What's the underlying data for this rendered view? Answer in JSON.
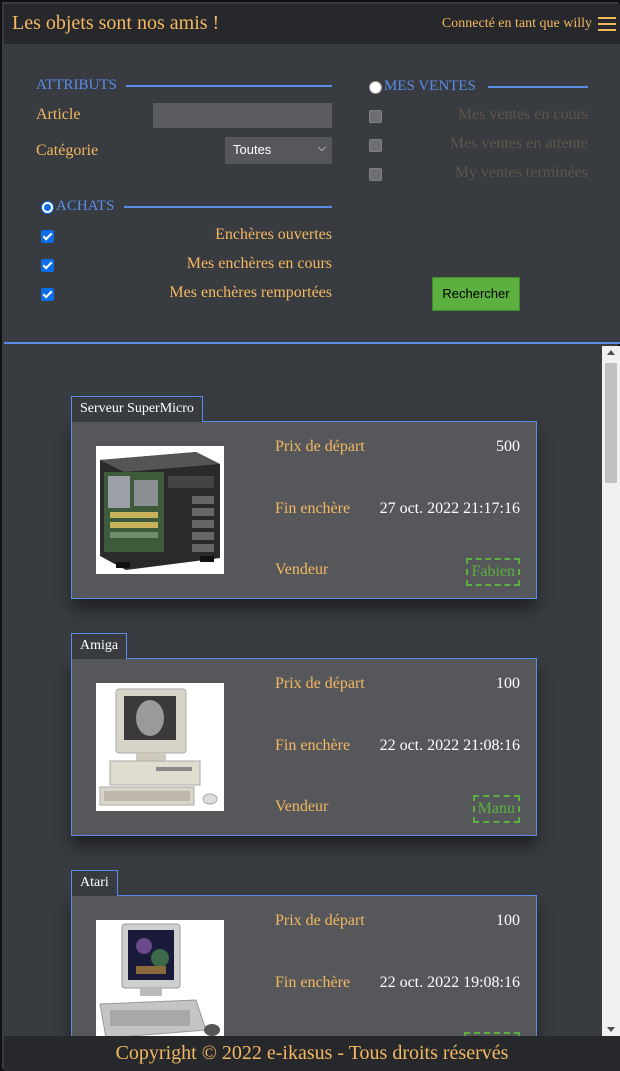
{
  "header": {
    "title": "Les objets sont nos amis !",
    "connected": "Connecté en tant que willy"
  },
  "filters": {
    "attributes_legend": "ATTRIBUTS",
    "article_label": "Article",
    "article_value": "",
    "category_label": "Catégorie",
    "category_selected": "Toutes",
    "sales_legend": "MES VENTES",
    "sales_options": [
      "Mes ventes en cours",
      "Mes ventes en attente",
      "My ventes terminées"
    ],
    "purchases_legend": "ACHATS",
    "purchase_options": [
      "Enchères ouvertes",
      "Mes enchères en cours",
      "Mes enchères remportées"
    ],
    "search_button": "Rechercher"
  },
  "listing_labels": {
    "start_price": "Prix de départ",
    "end_date": "Fin enchère",
    "seller": "Vendeur"
  },
  "items": [
    {
      "name": "Serveur SuperMicro",
      "start_price": "500",
      "end_date": "27 oct. 2022 21:17:16",
      "seller": "Fabien"
    },
    {
      "name": "Amiga",
      "start_price": "100",
      "end_date": "22 oct. 2022 21:08:16",
      "seller": "Manu"
    },
    {
      "name": "Atari",
      "start_price": "100",
      "end_date": "22 oct. 2022 19:08:16",
      "seller": ""
    }
  ],
  "footer": {
    "copyright": "Copyright © 2022 e-ikasus - Tous droits réservés"
  },
  "colors": {
    "accent": "#f4b860",
    "border_blue": "#5b8de8",
    "green": "#5cb040"
  }
}
